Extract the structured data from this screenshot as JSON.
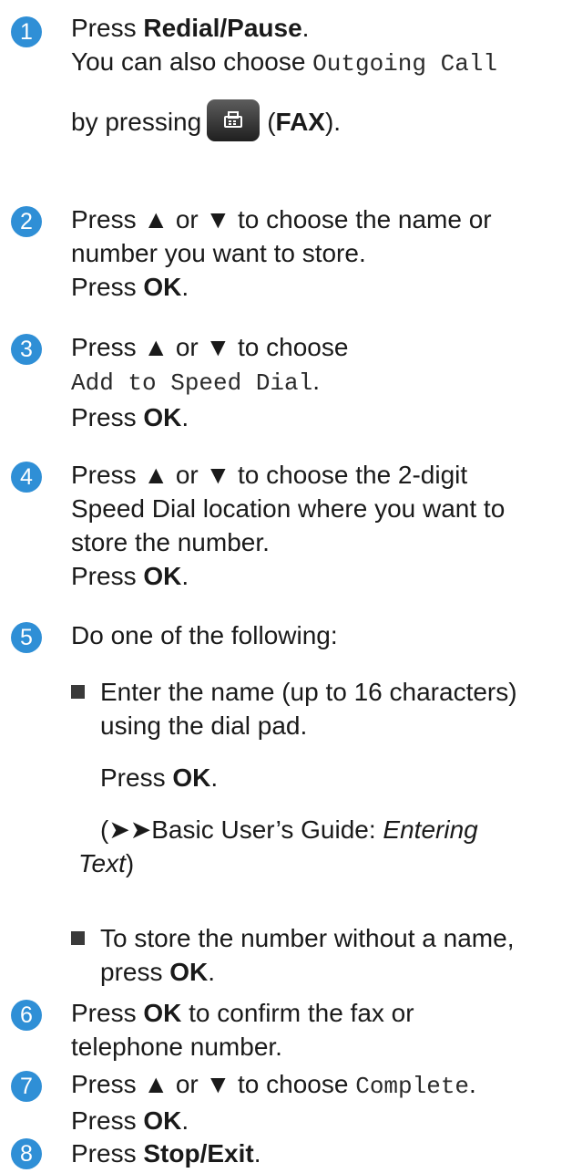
{
  "steps": [
    {
      "number": "1",
      "press": "Press ",
      "button": "Redial/Pause",
      "tail": ".",
      "also_choose": "You can also choose ",
      "option": "Outgoing Call",
      "by_pressing": "by pressing",
      "fax_open": "(",
      "fax_label": "FAX",
      "fax_close": ")."
    },
    {
      "number": "2",
      "line1": "Press ▲ or ▼ to choose the name or",
      "line2": "number you want to store.",
      "press": "Press ",
      "ok": "OK",
      "tail": "."
    },
    {
      "number": "3",
      "line1": "Press ▲ or ▼ to choose",
      "option": "Add to Speed Dial",
      "option_tail": ".",
      "press": "Press ",
      "ok": "OK",
      "tail": "."
    },
    {
      "number": "4",
      "line1": "Press ▲ or ▼ to choose the 2-digit",
      "line2": "Speed Dial location where you want to",
      "line3": "store the number.",
      "press": "Press ",
      "ok": "OK",
      "tail": "."
    },
    {
      "number": "5",
      "line1": "Do one of the following:",
      "bullets": [
        {
          "line1": "Enter the name (up to 16 characters)",
          "line2": "using the dial pad.",
          "press": "Press ",
          "ok": "OK",
          "tail": ".",
          "ref_open": "(➤➤Basic User’s Guide: ",
          "ref_italic1": "Entering",
          "ref_italic2": "Text",
          "ref_close": ")"
        },
        {
          "line1": "To store the number without a name,",
          "press": "press ",
          "ok": "OK",
          "tail": "."
        }
      ]
    },
    {
      "number": "6",
      "press": "Press ",
      "ok": "OK",
      "line1_tail": " to confirm the fax or",
      "line2": "telephone number."
    },
    {
      "number": "7",
      "line1": "Press ▲ or ▼ to choose ",
      "option": "Complete",
      "option_tail": ".",
      "press": "Press ",
      "ok": "OK",
      "tail": "."
    },
    {
      "number": "8",
      "press": "Press ",
      "button": "Stop/Exit",
      "tail": "."
    }
  ],
  "colors": {
    "step_badge": "#2f8fd6",
    "text": "#1a1a1a",
    "fax_button": "#2b2b2b"
  },
  "icons": {
    "fax_button": "fax-icon",
    "bullet": "square-bullet-icon"
  }
}
